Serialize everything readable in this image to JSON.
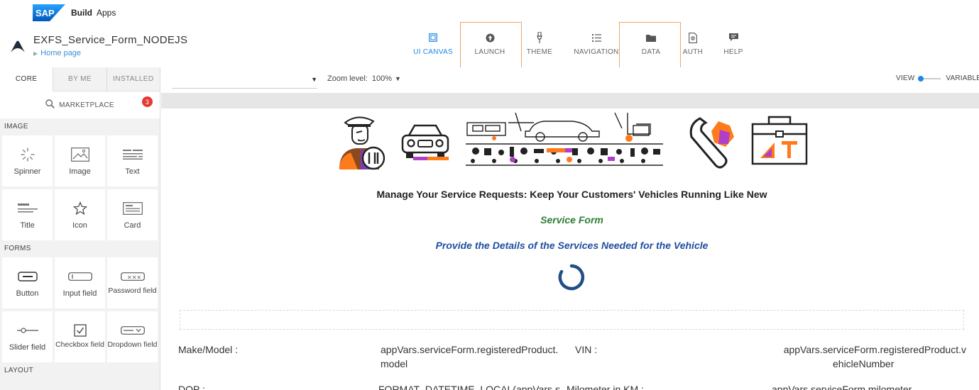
{
  "brand": {
    "logo_text": "SAP",
    "name": "Build",
    "product": "Apps"
  },
  "project": {
    "title": "EXFS_Service_Form_NODEJS",
    "breadcrumb": "Home page"
  },
  "top_nav": [
    {
      "label": "UI CANVAS",
      "icon": "ui-canvas-icon",
      "active": true
    },
    {
      "label": "LAUNCH",
      "icon": "launch-icon",
      "active": false
    },
    {
      "label": "THEME",
      "icon": "theme-brush-icon",
      "active": false
    },
    {
      "label": "NAVIGATION",
      "icon": "navigation-list-icon",
      "active": false
    },
    {
      "label": "DATA",
      "icon": "data-folder-icon",
      "active": false
    },
    {
      "label": "AUTH",
      "icon": "auth-document-icon",
      "active": false
    },
    {
      "label": "HELP",
      "icon": "help-chat-icon",
      "active": false
    }
  ],
  "left_panel": {
    "tabs": [
      "CORE",
      "BY ME",
      "INSTALLED"
    ],
    "marketplace": {
      "label": "MARKETPLACE",
      "badge": "3"
    },
    "sections": {
      "image": {
        "label": "IMAGE",
        "items": [
          "Spinner",
          "Image",
          "Text",
          "Title",
          "Icon",
          "Card"
        ]
      },
      "forms": {
        "label": "FORMS",
        "items": [
          "Button",
          "Input field",
          "Password field",
          "Slider field",
          "Checkbox field",
          "Dropdown field"
        ]
      },
      "layout": {
        "label": "LAYOUT"
      }
    }
  },
  "canvas_toolbar": {
    "page_select_value": "",
    "zoom_label": "Zoom level:",
    "zoom_value": "100%",
    "view_label": "VIEW",
    "variables_label": "VARIABLES"
  },
  "canvas": {
    "headline": "Manage Your Service Requests: Keep Your Customers' Vehicles Running Like New",
    "form_title": "Service Form",
    "form_subtitle": "Provide the Details of the Services Needed for the Vehicle",
    "colors": {
      "green": "#2e7d32",
      "blue": "#1f4fa0",
      "accent": "#1e88e5",
      "highlight": "#f0a36a"
    },
    "fields": {
      "make_model_label": "Make/Model :",
      "make_model_value_1": "appVars.serviceForm.registeredProduct.",
      "make_model_value_2": "model",
      "vin_label": "VIN :",
      "vin_value_1": "appVars.serviceForm.registeredProduct.v",
      "vin_value_2": "ehicleNumber",
      "dop_label": "DOP :",
      "dop_value": "FORMAT_DATETIME_LOCAL(appVars.s",
      "milometer_label": "Milometer in KM :",
      "milometer_value": "appVars.serviceForm.milometer"
    }
  }
}
